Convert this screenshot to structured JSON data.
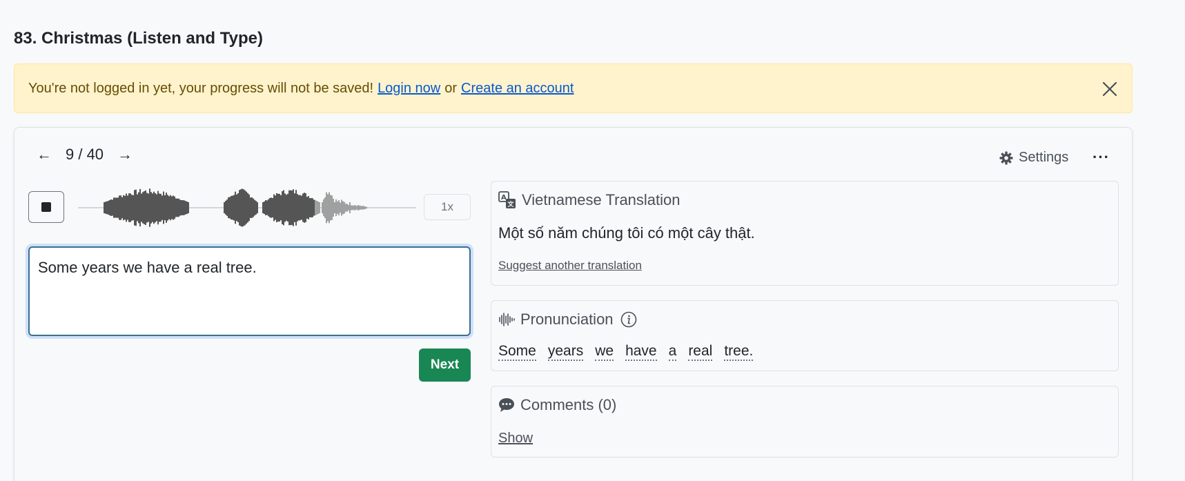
{
  "page": {
    "title": "83. Christmas (Listen and Type)"
  },
  "alert": {
    "message": "You're not logged in yet, your progress will not be saved!",
    "login_label": "Login now",
    "separator": "or",
    "create_label": "Create an account"
  },
  "nav": {
    "prev": "←",
    "counter": "9 / 40",
    "next": "→"
  },
  "toolbar": {
    "settings_label": "Settings",
    "more_label": "···"
  },
  "player": {
    "speed_label": "1x",
    "progress": 0.7
  },
  "answer": {
    "value": "Some years we have a real tree."
  },
  "actions": {
    "next_label": "Next"
  },
  "translation": {
    "heading": "Vietnamese Translation",
    "text": "Một số năm chúng tôi có một cây thật.",
    "suggest_label": "Suggest another translation"
  },
  "pronunciation": {
    "heading": "Pronunciation",
    "words": [
      "Some",
      "years",
      "we",
      "have",
      "a",
      "real",
      "tree."
    ]
  },
  "comments": {
    "heading": "Comments (0)",
    "show_label": "Show"
  },
  "colors": {
    "accent_green": "#198754",
    "alert_bg": "#fff3cd",
    "link": "#0a58ca"
  }
}
